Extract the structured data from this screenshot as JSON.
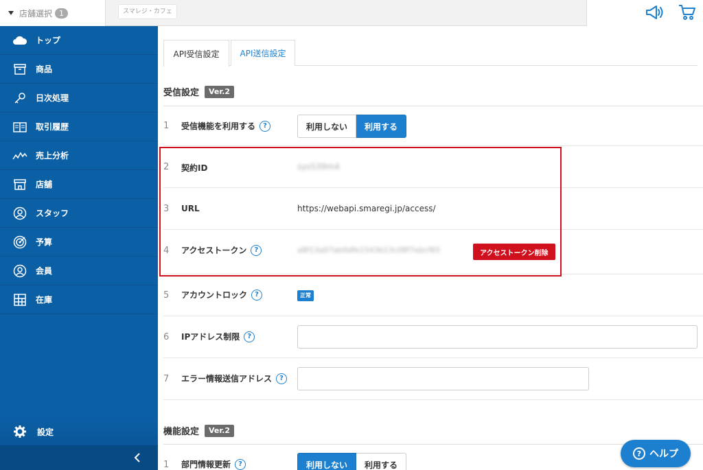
{
  "header": {
    "store_select_label": "店舗選択",
    "store_count": "1",
    "store_name": "スマレジ・カフェ",
    "icons": [
      "megaphone-icon",
      "cart-icon"
    ]
  },
  "sidebar": {
    "items": [
      {
        "label": "トップ",
        "icon": "cloud-icon"
      },
      {
        "label": "商品",
        "icon": "box-icon"
      },
      {
        "label": "日次処理",
        "icon": "key-icon"
      },
      {
        "label": "取引履歴",
        "icon": "book-icon"
      },
      {
        "label": "売上分析",
        "icon": "chart-line-icon"
      },
      {
        "label": "店舗",
        "icon": "store-icon"
      },
      {
        "label": "スタッフ",
        "icon": "staff-icon"
      },
      {
        "label": "予算",
        "icon": "target-icon"
      },
      {
        "label": "会員",
        "icon": "member-icon"
      },
      {
        "label": "在庫",
        "icon": "grid-icon"
      }
    ],
    "settings_label": "設定",
    "collapse_icon": "chevron-left-icon"
  },
  "tabs": [
    {
      "label": "API受信設定",
      "active": true
    },
    {
      "label": "API送信設定",
      "active": false
    }
  ],
  "receive_section": {
    "title": "受信設定",
    "version": "Ver.2",
    "rows": {
      "r1": {
        "num": "1",
        "label": "受信機能を利用する",
        "off_label": "利用しない",
        "on_label": "利用する",
        "selected": "利用する"
      },
      "r2": {
        "num": "2",
        "label": "契約ID",
        "value": "sys539m4"
      },
      "r3": {
        "num": "3",
        "label": "URL",
        "value": "https://webapi.smaregi.jp/access/"
      },
      "r4": {
        "num": "4",
        "label": "アクセストークン",
        "value": "a8f13a07ab0dfe1543b13c08f7ebcf65",
        "delete_label": "アクセストークン削除"
      },
      "r5": {
        "num": "5",
        "label": "アカウントロック",
        "status": "正常"
      },
      "r6": {
        "num": "6",
        "label": "IPアドレス制限",
        "value": ""
      },
      "r7": {
        "num": "7",
        "label": "エラー情報送信アドレス",
        "value": ""
      }
    }
  },
  "function_section": {
    "title": "機能設定",
    "version": "Ver.2",
    "rows": {
      "r1": {
        "num": "1",
        "label": "部門情報更新",
        "off_label": "利用しない",
        "on_label": "利用する",
        "selected": "利用しない"
      }
    }
  },
  "help_button": {
    "label": "ヘルプ",
    "icon": "question-circle-icon"
  },
  "colors": {
    "sidebar": "#0b5fa5",
    "accent": "#1c7fcf",
    "danger": "#d0101d",
    "version_badge": "#6b6b6b"
  }
}
